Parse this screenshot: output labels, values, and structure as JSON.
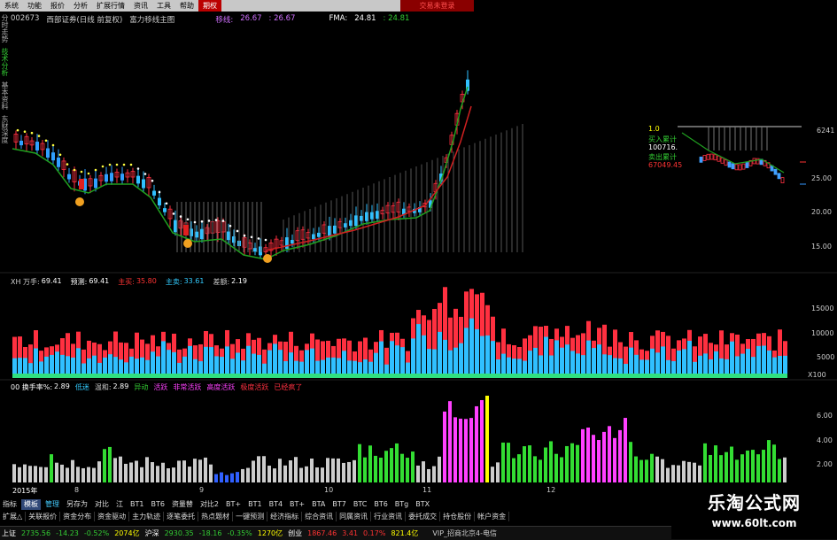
{
  "menu": {
    "items": [
      "系统",
      "功能",
      "报价",
      "分析",
      "扩展行情",
      "资讯",
      "工具",
      "帮助"
    ],
    "active": "期权",
    "trade_button": "交易未登录"
  },
  "title": {
    "code": "002673",
    "name": "西部证券(日线 前复权)",
    "template": "富力移线主图",
    "indicator1_label": "移线:",
    "indicator1_v1": "26.67",
    "indicator1_v2": ": 26.67",
    "fma_label": "FMA:",
    "fma_v1": "24.81",
    "fma_v2": ": 24.81"
  },
  "sidebar": [
    "分时走势",
    "技术分析",
    "基本资料",
    "东财深度"
  ],
  "price_axis": [
    "25.00",
    "20.00",
    "15.00"
  ],
  "price_axis_top": "6241",
  "inset": {
    "top_value": "1.0",
    "buy_label": "买入累计",
    "buy_value": "100716.",
    "sell_label": "卖出累计",
    "sell_value": "67049.45"
  },
  "indicator_row1": {
    "name": "XH 万手:",
    "v1": "69.41",
    "predict_label": "预测:",
    "predict_value": "69.41",
    "buy_label": "主买:",
    "buy_value": "35.80",
    "sell_label": "主卖:",
    "sell_value": "33.61",
    "diff_label": "差额:",
    "diff_value": "2.19"
  },
  "volume_axis": [
    "15000",
    "10000",
    "5000",
    "X100"
  ],
  "indicator_row2": {
    "name": "00 换手率%:",
    "v1": "2.89",
    "low": "低迷",
    "mild_label": "温和:",
    "mild_value": "2.89",
    "items": [
      "异动",
      "活跃",
      "非常活跃",
      "高度活跃",
      "极度活跃",
      "已经疯了"
    ]
  },
  "turnover_axis": [
    "6.00",
    "4.00",
    "2.00"
  ],
  "x_axis": [
    "2015年",
    "8",
    "9",
    "10",
    "11",
    "12"
  ],
  "tabs": [
    "指标",
    "模板",
    "管理",
    "另存为",
    "对比",
    "江",
    "BT1",
    "BT6",
    "资量替",
    "对比2",
    "BT+",
    "BT1",
    "BT4",
    "BT+",
    "BTA",
    "BT7",
    "BTC",
    "BT6",
    "BTg",
    "BTX"
  ],
  "tools": [
    "扩展△",
    "关联报价",
    "资金分布",
    "资金驱动",
    "主力轨迹",
    "逐笔委托",
    "热点题材",
    "一键预测",
    "经济指标",
    "综合资讯",
    "同属资讯",
    "行业资讯",
    "委托成交",
    "持仓股份",
    "帐户资金"
  ],
  "status": {
    "sh_label": "上证",
    "sh_value": "2735.56",
    "sh_change": "-14.23",
    "sh_pct": "-0.52%",
    "sh_amount": "2074亿",
    "sz_label": "沪深",
    "sz_value": "2930.35",
    "sz_change": "-18.16",
    "sz_pct": "-0.35%",
    "sz_amount": "1270亿",
    "cy_label": "创业",
    "cy_value": "1867.46",
    "cy_change": "3.41",
    "cy_pct": "0.17%",
    "cy_amount": "821.4亿",
    "vip": "VIP_招商北京4-电信"
  },
  "watermark": {
    "title": "乐淘公式网",
    "url": "www.60lt.com"
  },
  "colors": {
    "up": "#ff3040",
    "down": "#30c0ff",
    "ma_red": "#d02020",
    "ma_green": "#20a020",
    "yellow": "#ffff00",
    "magenta": "#ff40ff",
    "green_bar": "#33dd33",
    "accent_blue": "#304878"
  }
}
